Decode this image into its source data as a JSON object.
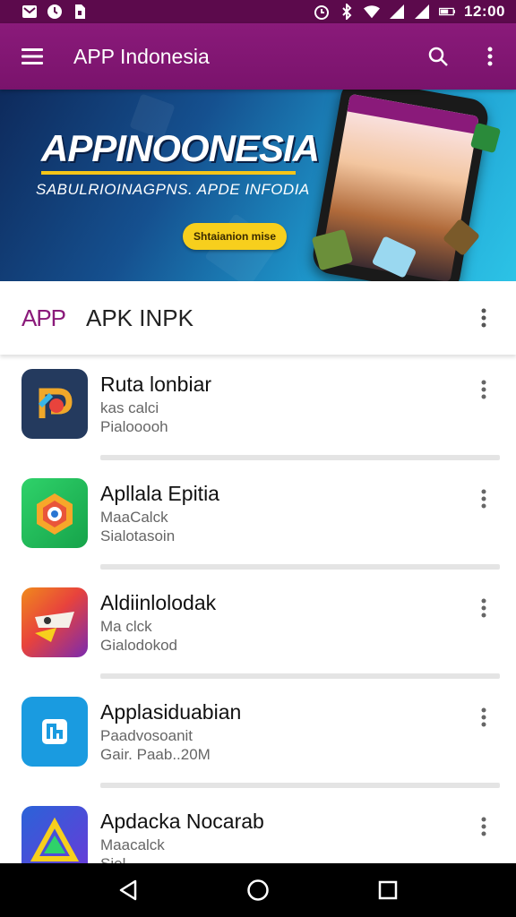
{
  "status": {
    "time": "12:00",
    "icons": [
      "gmail-icon",
      "clock-icon",
      "sim-icon",
      "alarm-icon",
      "bluetooth-icon",
      "wifi-icon",
      "signal-icon",
      "signal-icon",
      "battery-icon"
    ]
  },
  "appbar": {
    "title": "APP Indonesia",
    "menu_icon": "hamburger-menu-icon",
    "search_icon": "search-icon",
    "overflow_icon": "more-vertical-icon"
  },
  "banner": {
    "title": "APPINOONESIA",
    "subtitle": "SABULRIOINAGPNS. APDE INFODIA",
    "cta": "Shtaianion mise"
  },
  "section": {
    "brand": "APP",
    "title": "APK INPK"
  },
  "apps": [
    {
      "name": "Ruta lonbiar",
      "line1": "kas calci",
      "line2": "Pialooooh"
    },
    {
      "name": "Apllala Epitia",
      "line1": "MaaCalck",
      "line2": "Sialotasoin"
    },
    {
      "name": "Aldiinlolodak",
      "line1": "Ma clck",
      "line2": "Gialodokod"
    },
    {
      "name": "Applasiduabian",
      "line1": "Paadvosoanit",
      "line2": "Gair. Paab..20M"
    },
    {
      "name": "Apdacka Nocarab",
      "line1": "Maacalck",
      "line2": "Siel..."
    }
  ],
  "colors": {
    "primary": "#7a136c",
    "status_bar": "#5c0a4c",
    "accent": "#f7cf1d"
  }
}
